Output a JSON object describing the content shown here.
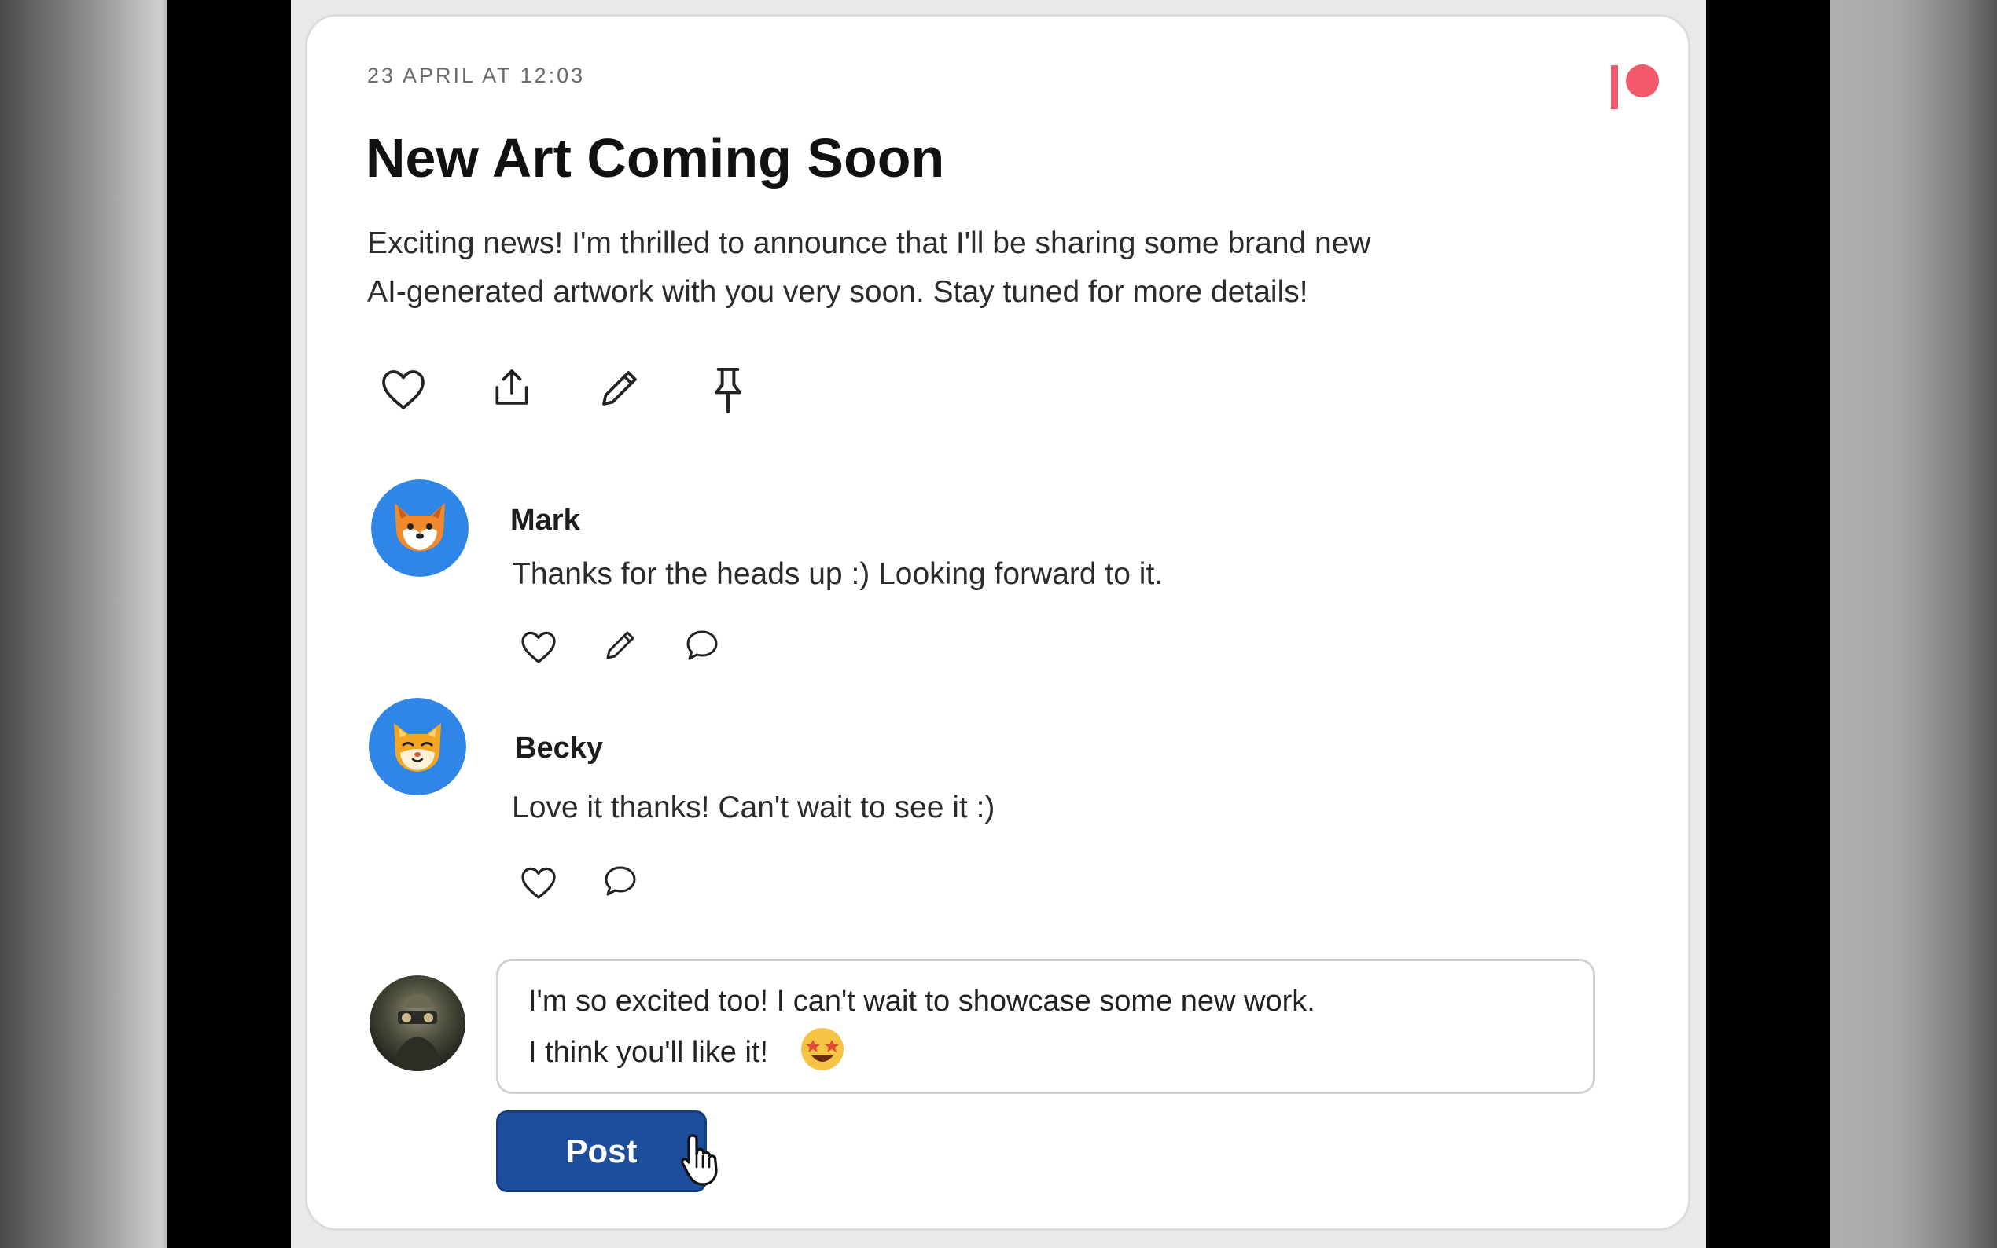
{
  "post": {
    "date": "23 APRIL AT 12:03",
    "title": "New Art Coming Soon",
    "body_line1": "Exciting news! I'm thrilled to announce that I'll be sharing some brand new",
    "body_line2": "AI-generated artwork with you very soon. Stay tuned for more details!",
    "actions": [
      "heart-icon",
      "share-icon",
      "edit-icon",
      "pin-icon"
    ],
    "brand_color": "#f2596b"
  },
  "comments": [
    {
      "name": "Mark",
      "text": "Thanks for the heads up :) Looking forward to it.",
      "actions": [
        "heart-icon",
        "edit-icon",
        "comment-icon"
      ],
      "avatar": "fox-avatar"
    },
    {
      "name": "Becky",
      "text": "Love it thanks! Can't wait to see it :)",
      "actions": [
        "heart-icon",
        "comment-icon"
      ],
      "avatar": "cat-avatar"
    }
  ],
  "reply": {
    "line1": "I'm so excited too! I can't wait to showcase some new work.",
    "line2": "I think you'll like it!",
    "emoji": "🤩",
    "avatar": "user-photo-avatar"
  },
  "post_button": {
    "label": "Post",
    "color": "#1c4e9b"
  },
  "colors": {
    "avatar_blue": "#2f86e6",
    "text": "#2b2b2b"
  }
}
